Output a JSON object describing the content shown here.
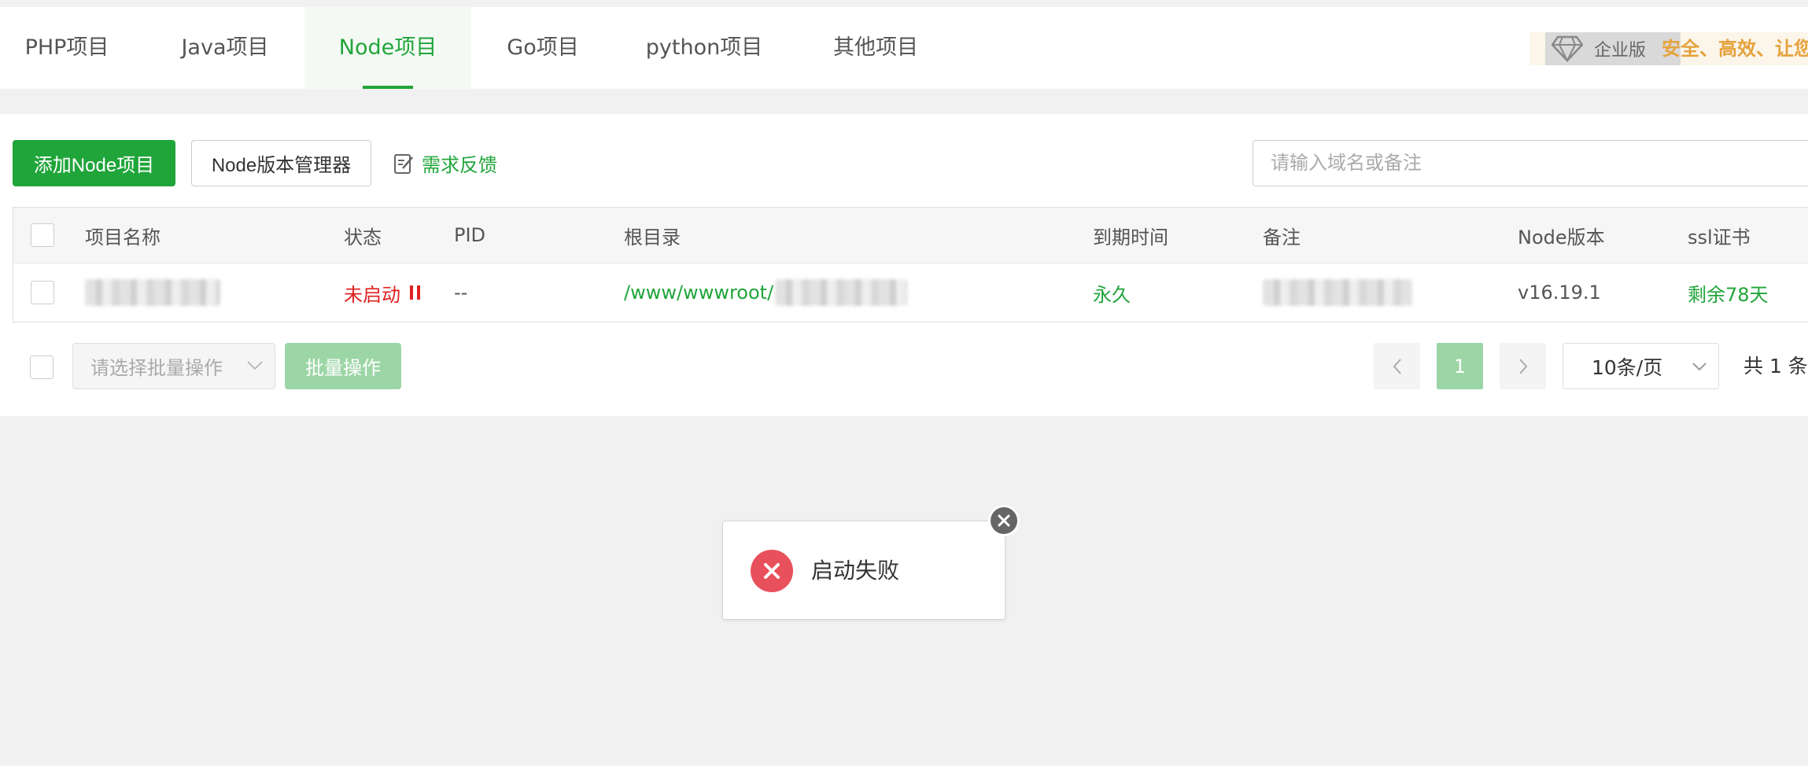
{
  "tabs": [
    {
      "label": "PHP项目"
    },
    {
      "label": "Java项目"
    },
    {
      "label": "Node项目"
    },
    {
      "label": "Go项目"
    },
    {
      "label": "python项目"
    },
    {
      "label": "其他项目"
    }
  ],
  "active_tab": "Node项目",
  "enterprise": {
    "badge": "企业版",
    "slogan": "安全、高效、让您"
  },
  "toolbar": {
    "add_label": "添加Node项目",
    "version_manager_label": "Node版本管理器",
    "feedback_label": "需求反馈",
    "search_placeholder": "请输入域名或备注"
  },
  "table": {
    "headers": {
      "name": "项目名称",
      "status": "状态",
      "pid": "PID",
      "root": "根目录",
      "expire": "到期时间",
      "remark": "备注",
      "node_version": "Node版本",
      "ssl": "ssl证书"
    },
    "rows": [
      {
        "status": "未启动",
        "pid": "--",
        "root_prefix": "/www/wwwroot/",
        "expire": "永久",
        "node_version": "v16.19.1",
        "ssl": "剩余78天"
      }
    ]
  },
  "footer": {
    "batch_select_placeholder": "请选择批量操作",
    "batch_button": "批量操作",
    "current_page": "1",
    "page_size": "10条/页",
    "total": "共 1 条"
  },
  "toast": {
    "message": "启动失败"
  },
  "colors": {
    "brand": "#20a53a",
    "error": "#e8505b",
    "warning_text": "#e6a23c"
  }
}
